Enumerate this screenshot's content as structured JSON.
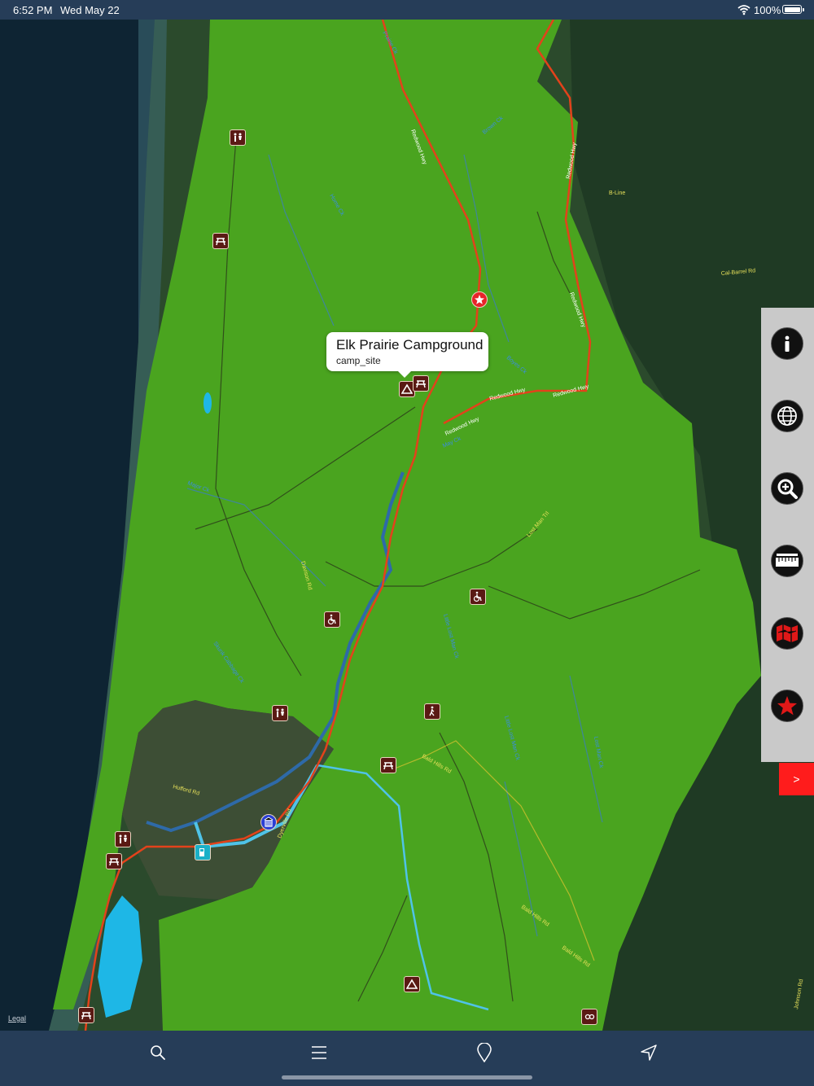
{
  "status_bar": {
    "time": "6:52 PM",
    "date": "Wed May 22",
    "battery_percent": "100%",
    "battery_level": 1.0
  },
  "map": {
    "callout": {
      "title": "Elk Prairie Campground",
      "subtitle": "camp_site"
    },
    "legal_link": "Legal",
    "road_labels": [
      "Redwood Hwy",
      "Redwood Hwy",
      "Redwood Hwy",
      "Redwood Hwy",
      "Redwood Hwy",
      "Redwood Hwy",
      "Cal-Barrel Rd",
      "B-Line",
      "Bald Hills Rd",
      "Bald Hills Rd",
      "Bald Hills Rd",
      "Davison Rd",
      "Dyerville Rd",
      "Hufford Rd",
      "Lost Man Trl",
      "Johnson Rd"
    ],
    "creek_labels": [
      "Boyes Ck",
      "May Ck",
      "Major Ck",
      "Skunk Cabbage Ck",
      "Little Lost Man Ck",
      "Lost Man Ck",
      "Home Ck",
      "Brown Ck",
      "Little Lost Man Ck",
      "Prairie Ck"
    ],
    "poi_icons": [
      "restroom-icon",
      "picnic-icon",
      "ranger-station-icon",
      "campground-icon",
      "picnic-icon",
      "accessible-icon",
      "accessible-icon",
      "restroom-icon",
      "trailhead-icon",
      "picnic-icon",
      "visitor-center-icon",
      "fuel-icon",
      "restroom-icon",
      "picnic-icon",
      "campground-icon",
      "picnic-icon",
      "viewpoint-icon"
    ]
  },
  "side_panel": {
    "buttons": [
      "info-icon",
      "globe-icon",
      "zoom-in-icon",
      "ruler-icon",
      "map-layers-icon",
      "favorites-star-icon"
    ],
    "expand_label": ">"
  },
  "toolbar": {
    "items": [
      "search-icon",
      "menu-icon",
      "pin-icon",
      "location-arrow-icon"
    ]
  },
  "colors": {
    "park_green": "#4aa41f",
    "ocean": "#0d2230",
    "road": "#e3421b",
    "river": "#4fc3e8",
    "toolbar": "#263d58",
    "callout_bg": "#ffffff",
    "poi_bg": "#5a1a14",
    "expand_button": "#ff1c1c"
  }
}
